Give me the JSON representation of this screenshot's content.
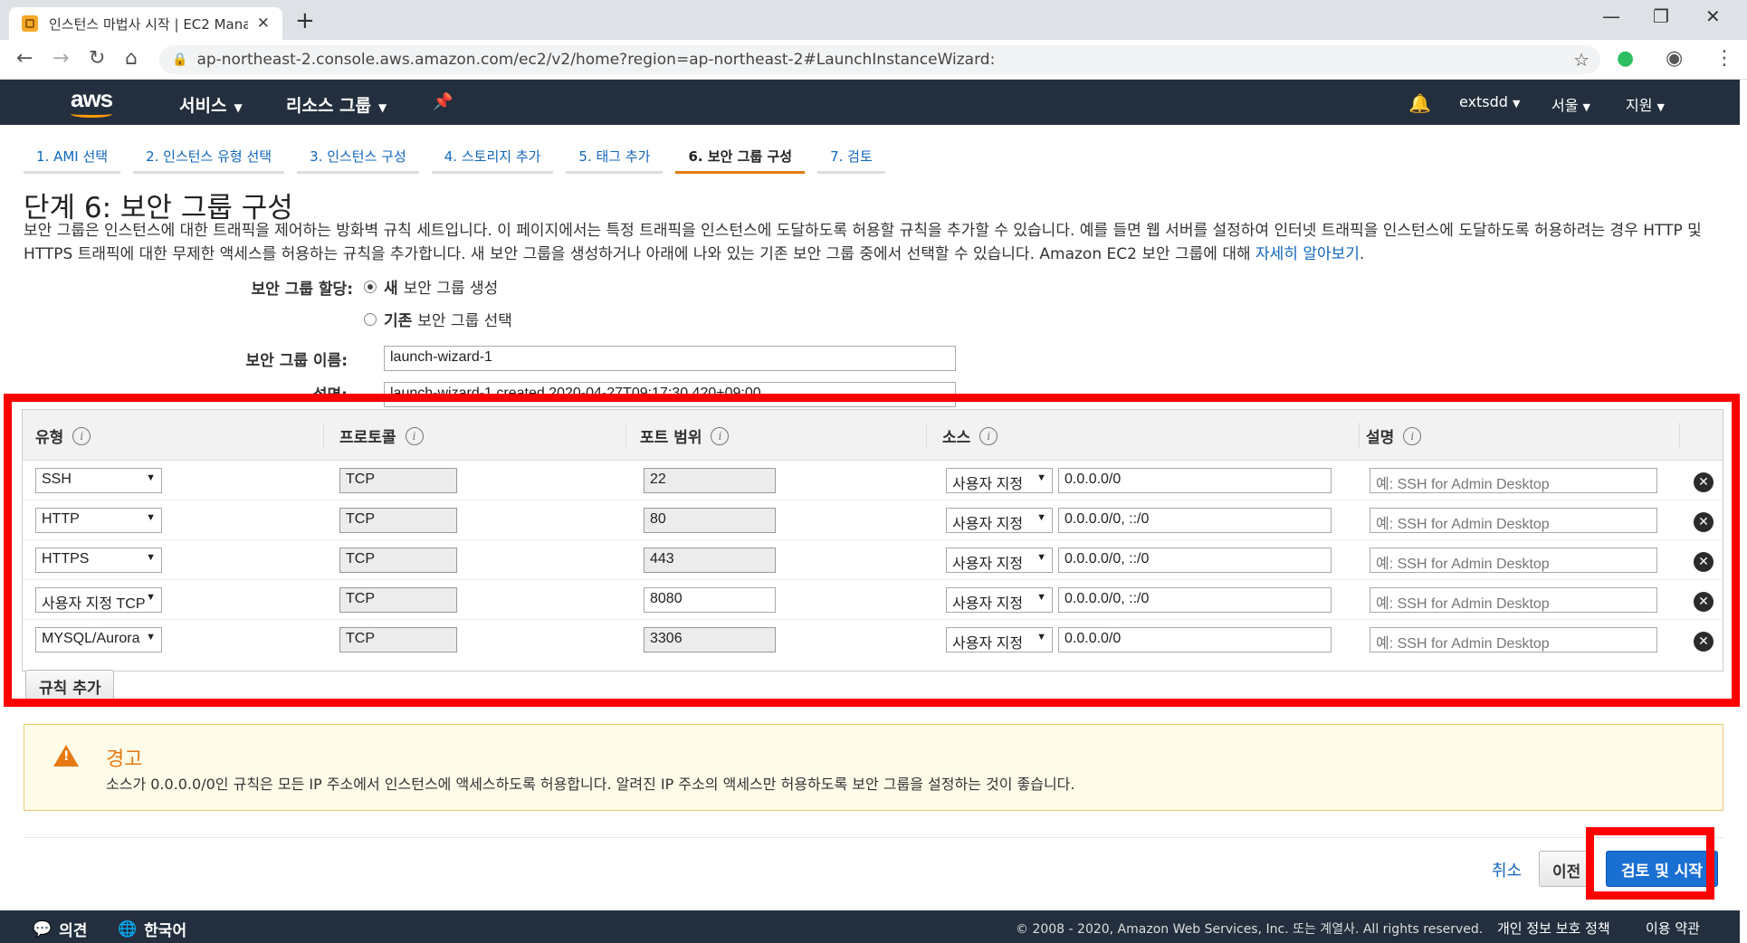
{
  "browser": {
    "tab_title": "인스턴스 마법사 시작 | EC2 Management Console",
    "url": "ap-northeast-2.console.aws.amazon.com/ec2/v2/home?region=ap-northeast-2#LaunchInstanceWizard:"
  },
  "aws_header": {
    "logo": "aws",
    "services": "서비스",
    "resource_groups": "리소스 그룹",
    "account": "extsdd",
    "region": "서울",
    "support": "지원"
  },
  "steps": [
    {
      "label": "1. AMI 선택"
    },
    {
      "label": "2. 인스턴스 유형 선택"
    },
    {
      "label": "3. 인스턴스 구성"
    },
    {
      "label": "4. 스토리지 추가"
    },
    {
      "label": "5. 태그 추가"
    },
    {
      "label": "6. 보안 그룹 구성"
    },
    {
      "label": "7. 검토"
    }
  ],
  "page": {
    "title": "단계 6: 보안 그룹 구성",
    "description": "보안 그룹은 인스턴스에 대한 트래픽을 제어하는 방화벽 규칙 세트입니다. 이 페이지에서는 특정 트래픽을 인스턴스에 도달하도록 허용할 규칙을 추가할 수 있습니다. 예를 들면 웹 서버를 설정하여 인터넷 트래픽을 인스턴스에 도달하도록 허용하려는 경우 HTTP 및 HTTPS 트래픽에 대한 무제한 액세스를 허용하는 규칙을 추가합니다. 새 보안 그룹을 생성하거나 아래에 나와 있는 기존 보안 그룹 중에서 선택할 수 있습니다. Amazon EC2 보안 그룹에 대해 ",
    "learn_more": "자세히 알아보기",
    "desc_end": "."
  },
  "form": {
    "assign_label": "보안 그룹 할당:",
    "option_new_bold": "새",
    "option_new_rest": "보안 그룹 생성",
    "option_existing_bold": "기존",
    "option_existing_rest": "보안 그룹 선택",
    "name_label": "보안 그룹 이름:",
    "name_value": "launch-wizard-1",
    "desc_label": "설명:",
    "desc_value": "launch-wizard-1 created 2020-04-27T09:17:30.420+09:00"
  },
  "table": {
    "headers": {
      "type": "유형",
      "protocol": "프로토콜",
      "port": "포트 범위",
      "source": "소스",
      "description": "설명"
    },
    "rows": [
      {
        "type": "SSH",
        "protocol": "TCP",
        "port": "22",
        "source_type": "사용자 지정",
        "source": "0.0.0.0/0",
        "desc_placeholder": "예: SSH for Admin Desktop"
      },
      {
        "type": "HTTP",
        "protocol": "TCP",
        "port": "80",
        "source_type": "사용자 지정",
        "source": "0.0.0.0/0, ::/0",
        "desc_placeholder": "예: SSH for Admin Desktop"
      },
      {
        "type": "HTTPS",
        "protocol": "TCP",
        "port": "443",
        "source_type": "사용자 지정",
        "source": "0.0.0.0/0, ::/0",
        "desc_placeholder": "예: SSH for Admin Desktop"
      },
      {
        "type": "사용자 지정 TCP",
        "protocol": "TCP",
        "port": "8080",
        "source_type": "사용자 지정",
        "source": "0.0.0.0/0, ::/0",
        "desc_placeholder": "예: SSH for Admin Desktop"
      },
      {
        "type": "MYSQL/Aurora",
        "protocol": "TCP",
        "port": "3306",
        "source_type": "사용자 지정",
        "source": "0.0.0.0/0",
        "desc_placeholder": "예: SSH for Admin Desktop"
      }
    ],
    "add_rule": "규칙 추가"
  },
  "warning": {
    "title": "경고",
    "message": "소스가 0.0.0.0/0인 규칙은 모든 IP 주소에서 인스턴스에 액세스하도록 허용합니다. 알려진 IP 주소의 액세스만 허용하도록 보안 그룹을 설정하는 것이 좋습니다."
  },
  "actions": {
    "cancel": "취소",
    "previous": "이전",
    "review_launch": "검토 및 시작"
  },
  "footer": {
    "feedback": "의견",
    "language": "한국어",
    "copyright": "© 2008 - 2020, Amazon Web Services, Inc. 또는 계열사. All rights reserved.",
    "privacy": "개인 정보 보호 정책",
    "terms": "이용 약관"
  }
}
